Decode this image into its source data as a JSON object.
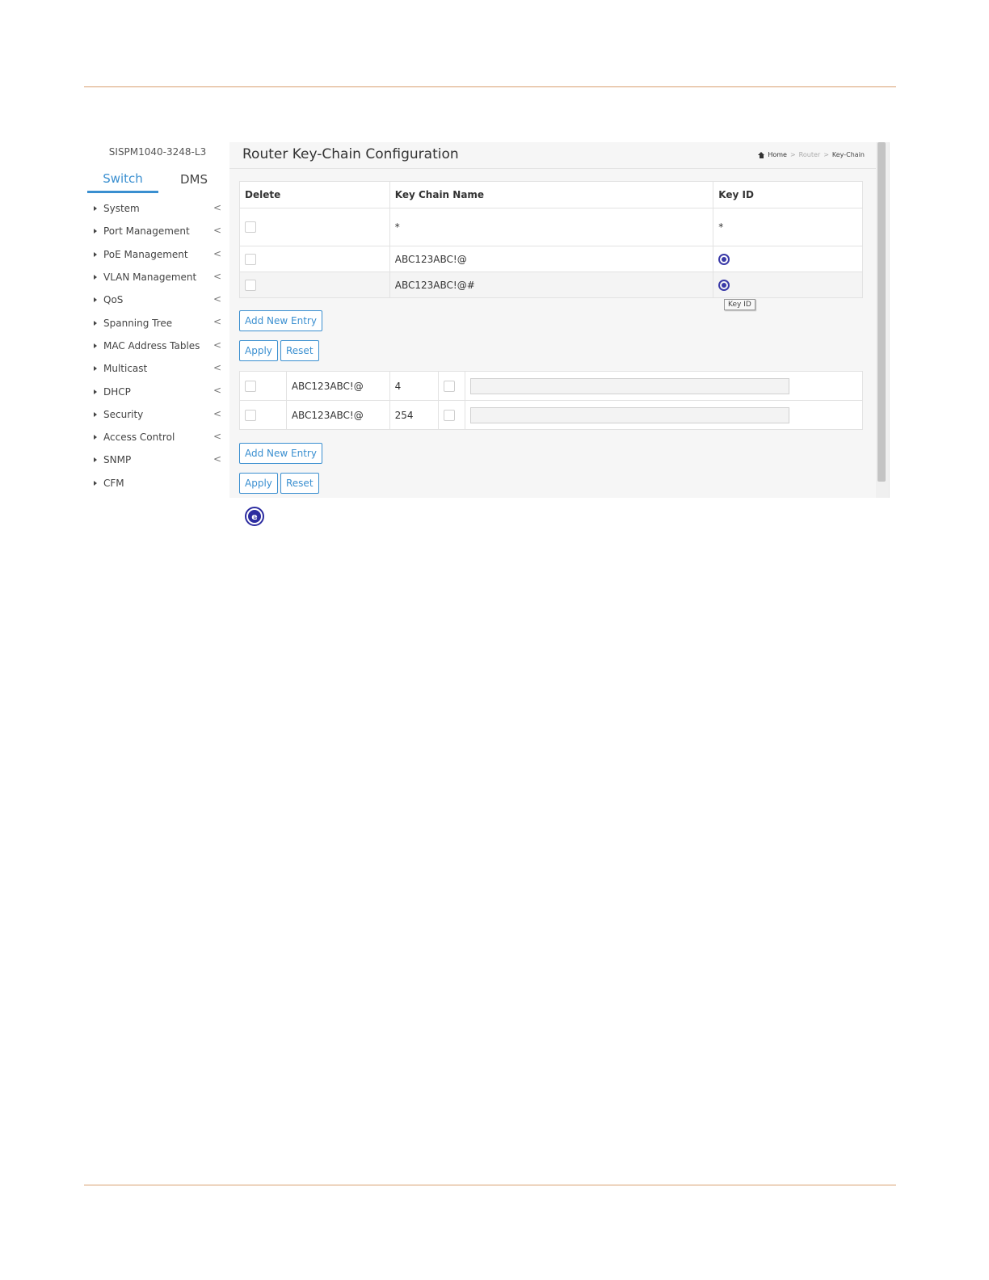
{
  "device": {
    "name": "SISPM1040-3248-L3"
  },
  "tabs": [
    {
      "label": "Switch"
    },
    {
      "label": "DMS"
    }
  ],
  "sidebar": {
    "items": [
      {
        "label": "System"
      },
      {
        "label": "Port Management"
      },
      {
        "label": "PoE Management"
      },
      {
        "label": "VLAN Management"
      },
      {
        "label": "QoS"
      },
      {
        "label": "Spanning Tree"
      },
      {
        "label": "MAC Address Tables"
      },
      {
        "label": "Multicast"
      },
      {
        "label": "DHCP"
      },
      {
        "label": "Security"
      },
      {
        "label": "Access Control"
      },
      {
        "label": "SNMP"
      },
      {
        "label": "CFM"
      }
    ],
    "chevron": "<"
  },
  "page": {
    "title": "Router Key-Chain Configuration",
    "breadcrumb": {
      "home": "Home",
      "section": "Router",
      "current": "Key-Chain",
      "separator": ">"
    }
  },
  "key_chain_table": {
    "headers": {
      "delete": "Delete",
      "name": "Key Chain Name",
      "key_id": "Key ID"
    },
    "rows": [
      {
        "name": "*",
        "key_id": "*"
      },
      {
        "name": "ABC123ABC!@"
      },
      {
        "name": "ABC123ABC!@#"
      }
    ]
  },
  "tooltip": "Key ID",
  "buttons": {
    "add_new_entry": "Add New Entry",
    "apply": "Apply",
    "reset": "Reset"
  },
  "key_table": {
    "rows": [
      {
        "chain": "ABC123ABC!@",
        "key_id": "4"
      },
      {
        "chain": "ABC123ABC!@",
        "key_id": "254"
      }
    ]
  },
  "colors": {
    "accent": "#3a8fd0",
    "icon": "#2c2ca0",
    "rule": "#d9a070"
  },
  "icons": {
    "key_id_select": "radio-button-icon",
    "edit": "edit-icon",
    "home": "home-icon"
  },
  "edit_icon_glyph": "e"
}
